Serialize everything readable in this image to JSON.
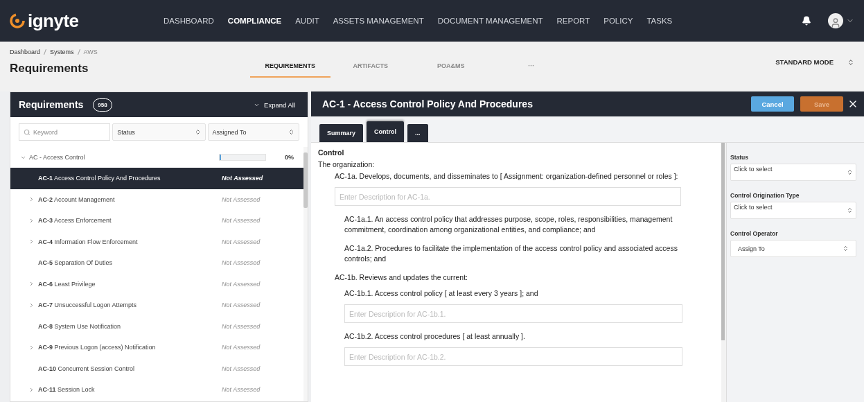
{
  "brand": {
    "name": "ignyte"
  },
  "nav": [
    {
      "label": "DASHBOARD",
      "selected": false
    },
    {
      "label": "COMPLIANCE",
      "selected": true
    },
    {
      "label": "AUDIT",
      "selected": false
    },
    {
      "label": "ASSETS MANAGEMENT",
      "selected": false
    },
    {
      "label": "DOCUMENT MANAGEMENT",
      "selected": false
    },
    {
      "label": "REPORT",
      "selected": false
    },
    {
      "label": "POLICY",
      "selected": false
    },
    {
      "label": "TASKS",
      "selected": false
    }
  ],
  "breadcrumb": [
    "Dashboard",
    "Systems",
    "AWS"
  ],
  "page_title": "Requirements",
  "page_tabs": [
    {
      "label": "REQUIREMENTS",
      "selected": true
    },
    {
      "label": "ARTIFACTS",
      "selected": false
    },
    {
      "label": "POA&MS",
      "selected": false
    },
    {
      "label": "···",
      "selected": false
    }
  ],
  "mode": "STANDARD MODE",
  "requirements": {
    "title": "Requirements",
    "count": "958",
    "expand_all": "Expand All",
    "search": {
      "placeholder": "Keyword"
    },
    "filters": [
      "Status",
      "Assigned To"
    ],
    "group": {
      "label": "AC - Access Control",
      "expanded": true,
      "level": 0,
      "percent": "0%",
      "items": [
        {
          "code": "AC-1",
          "name": "Access Control Policy And Procedures",
          "status": "Not Assessed",
          "has_children": false,
          "selected": true
        },
        {
          "code": "AC-2",
          "name": "Account Management",
          "status": "Not Assessed",
          "has_children": true,
          "selected": false
        },
        {
          "code": "AC-3",
          "name": "Access Enforcement",
          "status": "Not Assessed",
          "has_children": true,
          "selected": false
        },
        {
          "code": "AC-4",
          "name": "Information Flow Enforcement",
          "status": "Not Assessed",
          "has_children": true,
          "selected": false
        },
        {
          "code": "AC-5",
          "name": "Separation Of Duties",
          "status": "Not Assessed",
          "has_children": false,
          "selected": false
        },
        {
          "code": "AC-6",
          "name": "Least Privilege",
          "status": "Not Assessed",
          "has_children": true,
          "selected": false
        },
        {
          "code": "AC-7",
          "name": "Unsuccessful Logon Attempts",
          "status": "Not Assessed",
          "has_children": true,
          "selected": false
        },
        {
          "code": "AC-8",
          "name": "System Use Notification",
          "status": "Not Assessed",
          "has_children": false,
          "selected": false
        },
        {
          "code": "AC-9",
          "name": "Previous Logon (access) Notification",
          "status": "Not Assessed",
          "has_children": true,
          "selected": false
        },
        {
          "code": "AC-10",
          "name": "Concurrent Session Control",
          "status": "Not Assessed",
          "has_children": false,
          "selected": false
        },
        {
          "code": "AC-11",
          "name": "Session Lock",
          "status": "Not Assessed",
          "has_children": true,
          "selected": false
        }
      ]
    }
  },
  "detail": {
    "title": "AC-1 - Access Control Policy And Procedures",
    "cancel": "Cancel",
    "save": "Save",
    "tabs": [
      {
        "label": "Summary",
        "selected": false
      },
      {
        "label": "Control",
        "selected": true
      },
      {
        "label": "...",
        "selected": false
      }
    ],
    "heading": "Control",
    "intro": "The organization:",
    "statements": [
      {
        "text": "AC-1a. Develops, documents, and disseminates to [ Assignment: organization-defined personnel or roles ]:",
        "placeholder": "Enter Description for AC-1a.",
        "children": [
          {
            "text": "AC-1a.1. An access control policy that addresses purpose, scope, roles, responsibilities, management commitment, coordination among organizational entities, and compliance; and"
          },
          {
            "text": "AC-1a.2. Procedures to facilitate the implementation of the access control policy and associated access controls; and"
          }
        ]
      },
      {
        "text": "AC-1b. Reviews and updates the current:",
        "children": [
          {
            "text": "AC-1b.1. Access control policy [ at least every 3 years ]; and",
            "placeholder": "Enter Description for AC-1b.1."
          },
          {
            "text": "AC-1b.2. Access control procedures [ at least annually ].",
            "placeholder": "Enter Description for AC-1b.2."
          }
        ]
      }
    ],
    "side_fields": [
      {
        "label": "Status",
        "value": "Click to select",
        "kind": "top"
      },
      {
        "label": "Control Origination Type",
        "value": "Click to select",
        "kind": "top"
      },
      {
        "label": "Control Operator",
        "value": "Assign To",
        "kind": "center"
      }
    ]
  }
}
